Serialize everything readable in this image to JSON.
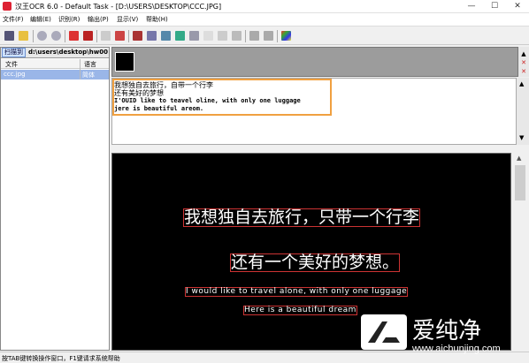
{
  "window": {
    "title": "汉王OCR 6.0 - Default Task - [D:\\USERS\\DESKTOP\\CCC.JPG]",
    "minimize": "—",
    "maximize": "☐",
    "close": "✕"
  },
  "menu": [
    "文件(F)",
    "编辑(E)",
    "识别(R)",
    "输出(P)",
    "显示(V)",
    "帮助(H)"
  ],
  "toolbar_icons": [
    "scan-icon",
    "open-folder-icon",
    "zoom-in-icon",
    "zoom-out-icon",
    "eraser-icon",
    "red-ocr-icon",
    "copy-icon",
    "page-icon",
    "layout-icon",
    "table-icon",
    "image-icon",
    "select-icon",
    "crop-icon",
    "pen-icon",
    "back-icon",
    "forward-icon",
    "colorful-icon"
  ],
  "left_panel": {
    "tab_label": "扫描到",
    "path": "d:\\users\\desktop\\hw00",
    "columns": [
      "文件",
      "语言"
    ],
    "rows": [
      {
        "file": "ccc.jpg",
        "lang": "简体"
      }
    ]
  },
  "recognized_text": [
    "我想独自去旅行，自带一个行李",
    "还有美好的梦想",
    "I'OUID like to teavel oline, with only one luggage",
    "jere is  beautiful areom."
  ],
  "image_lines": [
    "我想独自去旅行，只带一个行李",
    "还有一个美好的梦想。",
    "I would like to travel alone, with only one luggage",
    "Here is a beautiful dream"
  ],
  "status": "按TAB键转换操作窗口，F1键请求系统帮助",
  "watermark": {
    "brand": "爱纯净",
    "url": "www.aichunjing.com"
  }
}
